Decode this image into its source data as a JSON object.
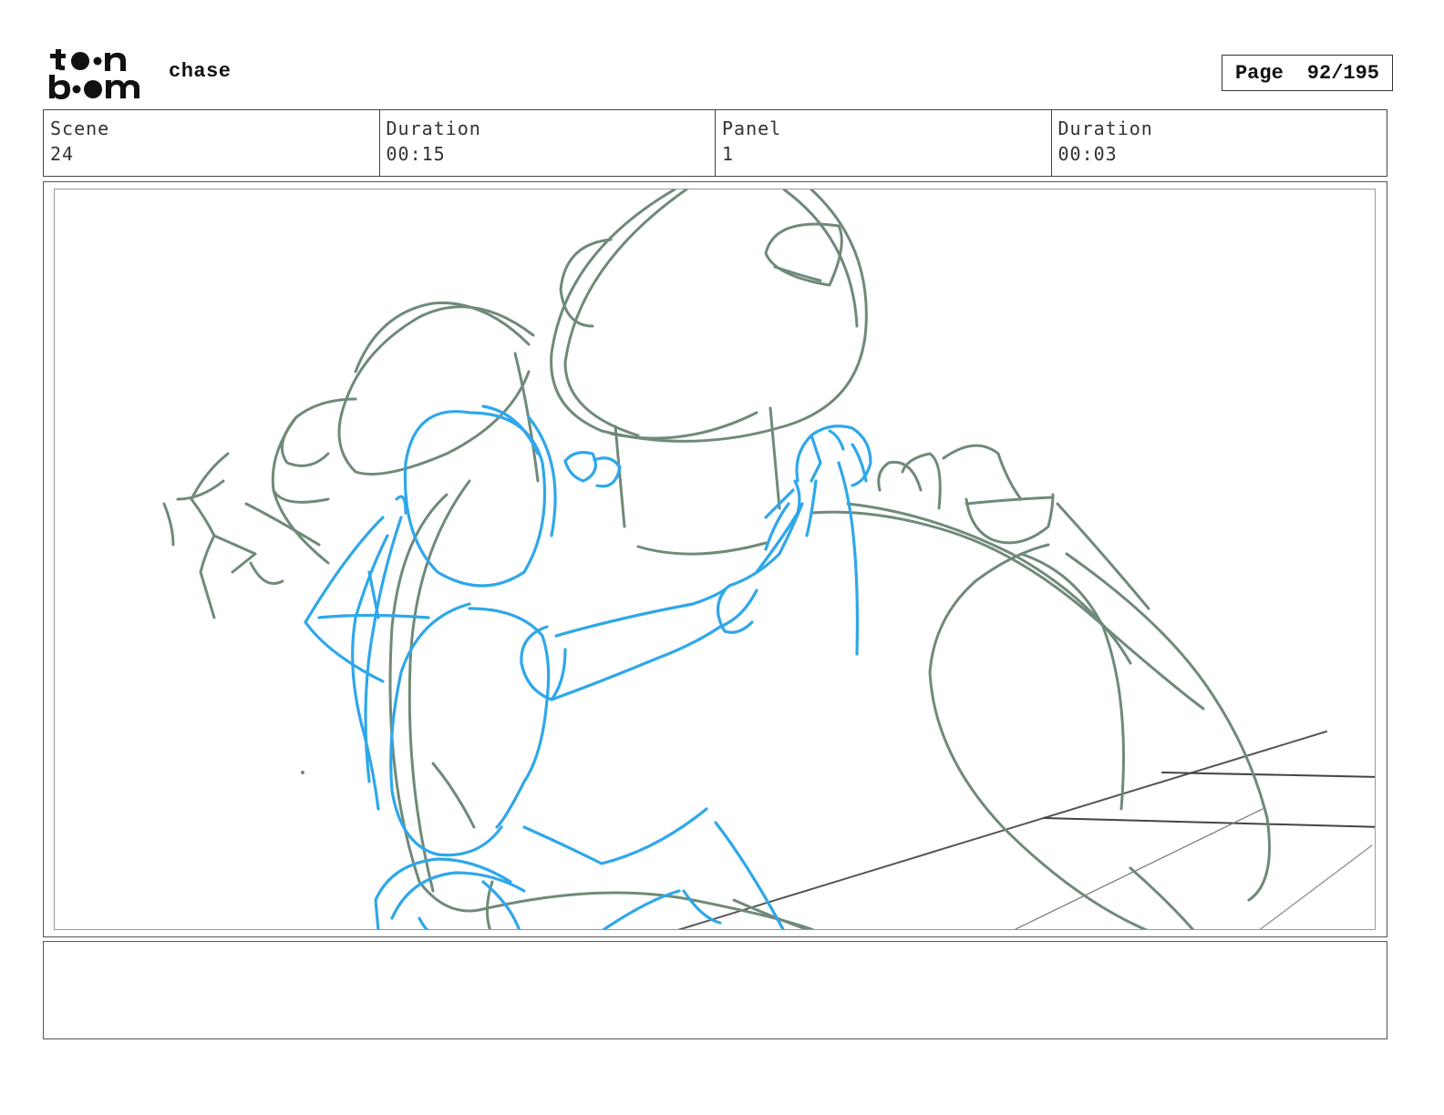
{
  "header": {
    "logo_text": "toon boom",
    "project_title": "chase",
    "page_label": "Page",
    "page_value": "92/195"
  },
  "info": {
    "scene_label": "Scene",
    "scene_value": "24",
    "scene_duration_label": "Duration",
    "scene_duration_value": "00:15",
    "panel_label": "Panel",
    "panel_value": "1",
    "panel_duration_label": "Duration",
    "panel_duration_value": "00:03"
  },
  "panel": {
    "sketch_colors": {
      "rough_green": "#6f8a78",
      "character_blue": "#2fa7ea",
      "perspective_gray": "#555555"
    }
  },
  "notes": {
    "text": ""
  }
}
